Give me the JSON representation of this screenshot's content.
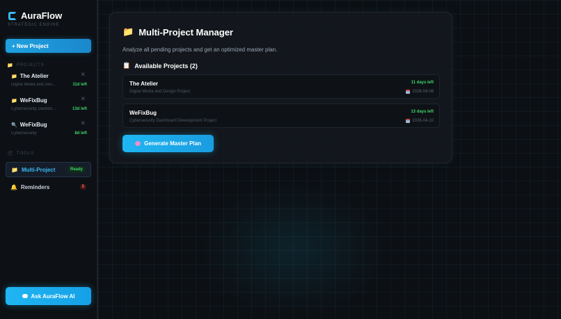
{
  "sidebar": {
    "brand_name": "AuraFlow",
    "brand_subtitle": "STRATEGIC ENGINE",
    "new_project_label": "+ New Project",
    "projects_section_label": "PROJECTS",
    "projects": [
      {
        "name": "The Atelier",
        "desc": "Digital Media and Des...",
        "days_left": "11d left",
        "icon": "folder-icon"
      },
      {
        "name": "WeFixBug",
        "desc": "Cybersecurity Dashbo...",
        "days_left": "13d left",
        "icon": "folder-icon"
      },
      {
        "name": "WeFixBug",
        "desc": "Cybersecurity",
        "days_left": "8d left",
        "icon": "search-icon"
      }
    ],
    "remove_glyph": "✕",
    "tools_section_label": "TOOLS",
    "tools": [
      {
        "label": "Multi-Project",
        "badge": "Ready",
        "icon": "folder-icon",
        "active": true
      },
      {
        "label": "Reminders",
        "badge": "5",
        "icon": "bell-icon",
        "active": false
      }
    ],
    "ask_ai_label": "Ask AuraFlow AI"
  },
  "main": {
    "title": "Multi-Project Manager",
    "subtitle": "Analyze all pending projects and get an optimized master plan.",
    "available_label": "Available Projects (2)",
    "project_cards": [
      {
        "name": "The Atelier",
        "desc": "Digital Media and Design Project",
        "days_left": "11 days left",
        "date": "2026-04-08"
      },
      {
        "name": "WeFixBug",
        "desc": "Cybersecurity Dashboard Development Project",
        "days_left": "13 days left",
        "date": "2026-04-10"
      }
    ],
    "generate_label": "Generate Master Plan"
  },
  "colors": {
    "accent": "#1fb6f3",
    "success": "#3fd46b",
    "danger": "#ff6b6b",
    "background": "#0b0d10"
  }
}
